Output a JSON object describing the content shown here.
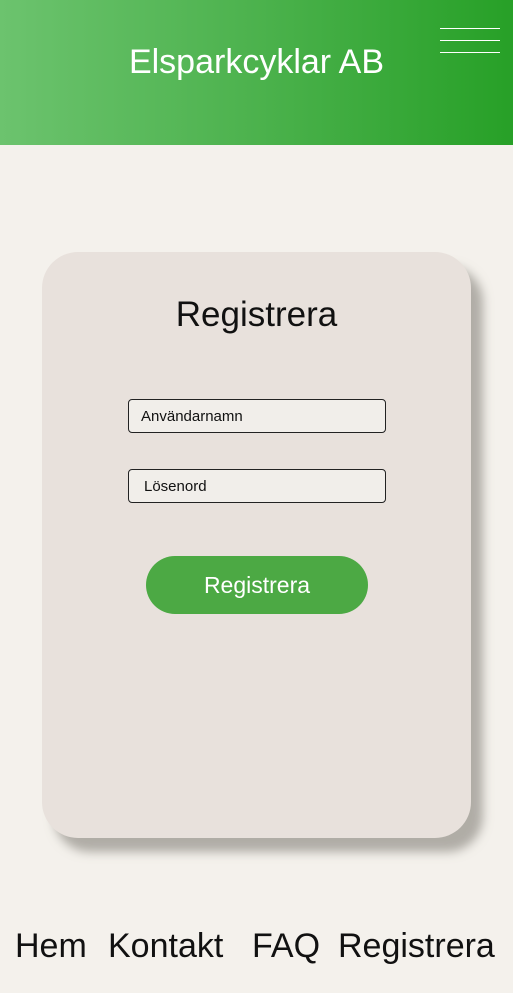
{
  "header": {
    "title": "Elsparkcyklar AB",
    "menu_icon": "hamburger-menu-icon"
  },
  "form": {
    "title": "Registrera",
    "username_placeholder": "Användarnamn",
    "password_placeholder": "Lösenord",
    "submit_label": "Registrera"
  },
  "footer": {
    "nav": [
      "Hem",
      "Kontakt",
      "FAQ",
      "Registrera"
    ]
  },
  "colors": {
    "header_gradient_start": "#6cc36e",
    "header_gradient_end": "#27a027",
    "button": "#4ca944",
    "card": "#e8e1dc",
    "page_background": "#f4f1ec"
  }
}
